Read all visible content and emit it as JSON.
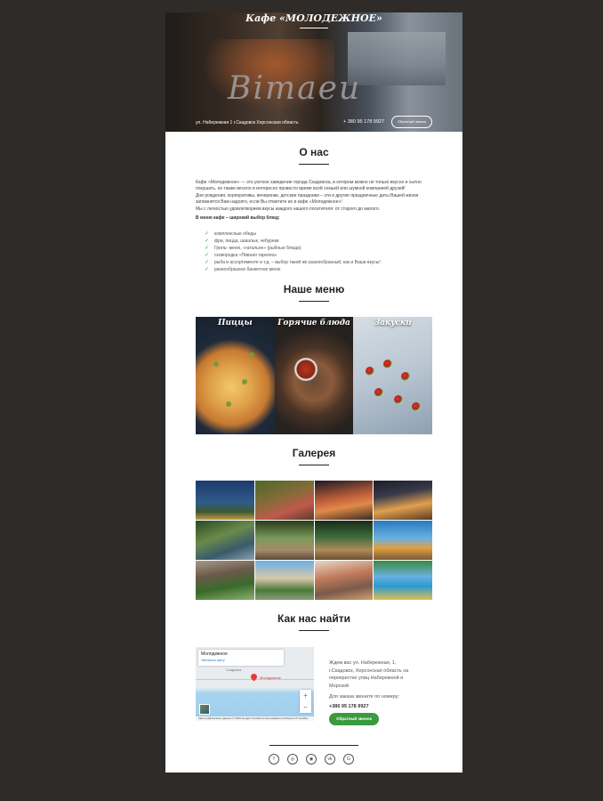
{
  "hero": {
    "title": "Кафе «МОЛОДЕЖНОЕ»",
    "sign_text": "Bimaeu",
    "address": "ул. Набережная 1 г.Скадовск Херсонская область",
    "phone": "+ 380 95 178 9927",
    "callback_label": "Обратный звонок"
  },
  "about": {
    "title": "О нас",
    "paragraphs": [
      "Кафе «Молодежное» — это уютное заведение города Скадовска, в котором можно не только вкусно и сытно покушать, но также весело и интересно провести время всей семьей или шумной компанией друзей!",
      "Дни рождения, корпоративы, вечеринки, детские праздники – эти и другие праздничные даты Вашей жизни запомнятся Вам надолго, если Вы отметите их в кафе «Молодежное»!",
      "Мы с легкостью удовлетворяем вкусы каждого нашего посетителя: от старого до малого."
    ],
    "subheading": "В меню кафе – широкий выбор блюд:",
    "list": [
      "комплексные обеды",
      "фри, пицца, шашлык, чебуреки",
      "Гриль- меню, «гатальне» (рыбные блюда)",
      "сковородка «Пивная тарелка»",
      "рыба в ассортименте и т.д. – выбор такой же разнообразный, как и Ваши вкусы!",
      "разнообразное банкетное меню"
    ]
  },
  "menu": {
    "title": "Наше меню",
    "cards": [
      "Пиццы",
      "Горячие блюда",
      "Закуски"
    ]
  },
  "gallery": {
    "title": "Галерея"
  },
  "find": {
    "title": "Как нас найти",
    "map": {
      "place_name": "Молодежное",
      "enlarge_link": "Увеличить карту",
      "pin_label": "Молодежное",
      "town_label": "Скадовск",
      "footer": "Картографические данные © 2019 Google  Условия использования  Сообщить об ошибке"
    },
    "address_text": "Ждем вас ул. Набережная, 1, г.Скадовск, Херсонская область на перекрестке улиц Набережной и Морской",
    "order_text": "Для заказа звоните по номеру:",
    "phone": "+380 95 178 9927",
    "callback_label": "Обратный звонок"
  },
  "footer": {
    "socials": [
      "f",
      "◎",
      "◉",
      "vk",
      "G"
    ]
  },
  "colors": {
    "background": "#2f2b28",
    "accent_green": "#3a9a3e",
    "text_dark": "#222222"
  }
}
